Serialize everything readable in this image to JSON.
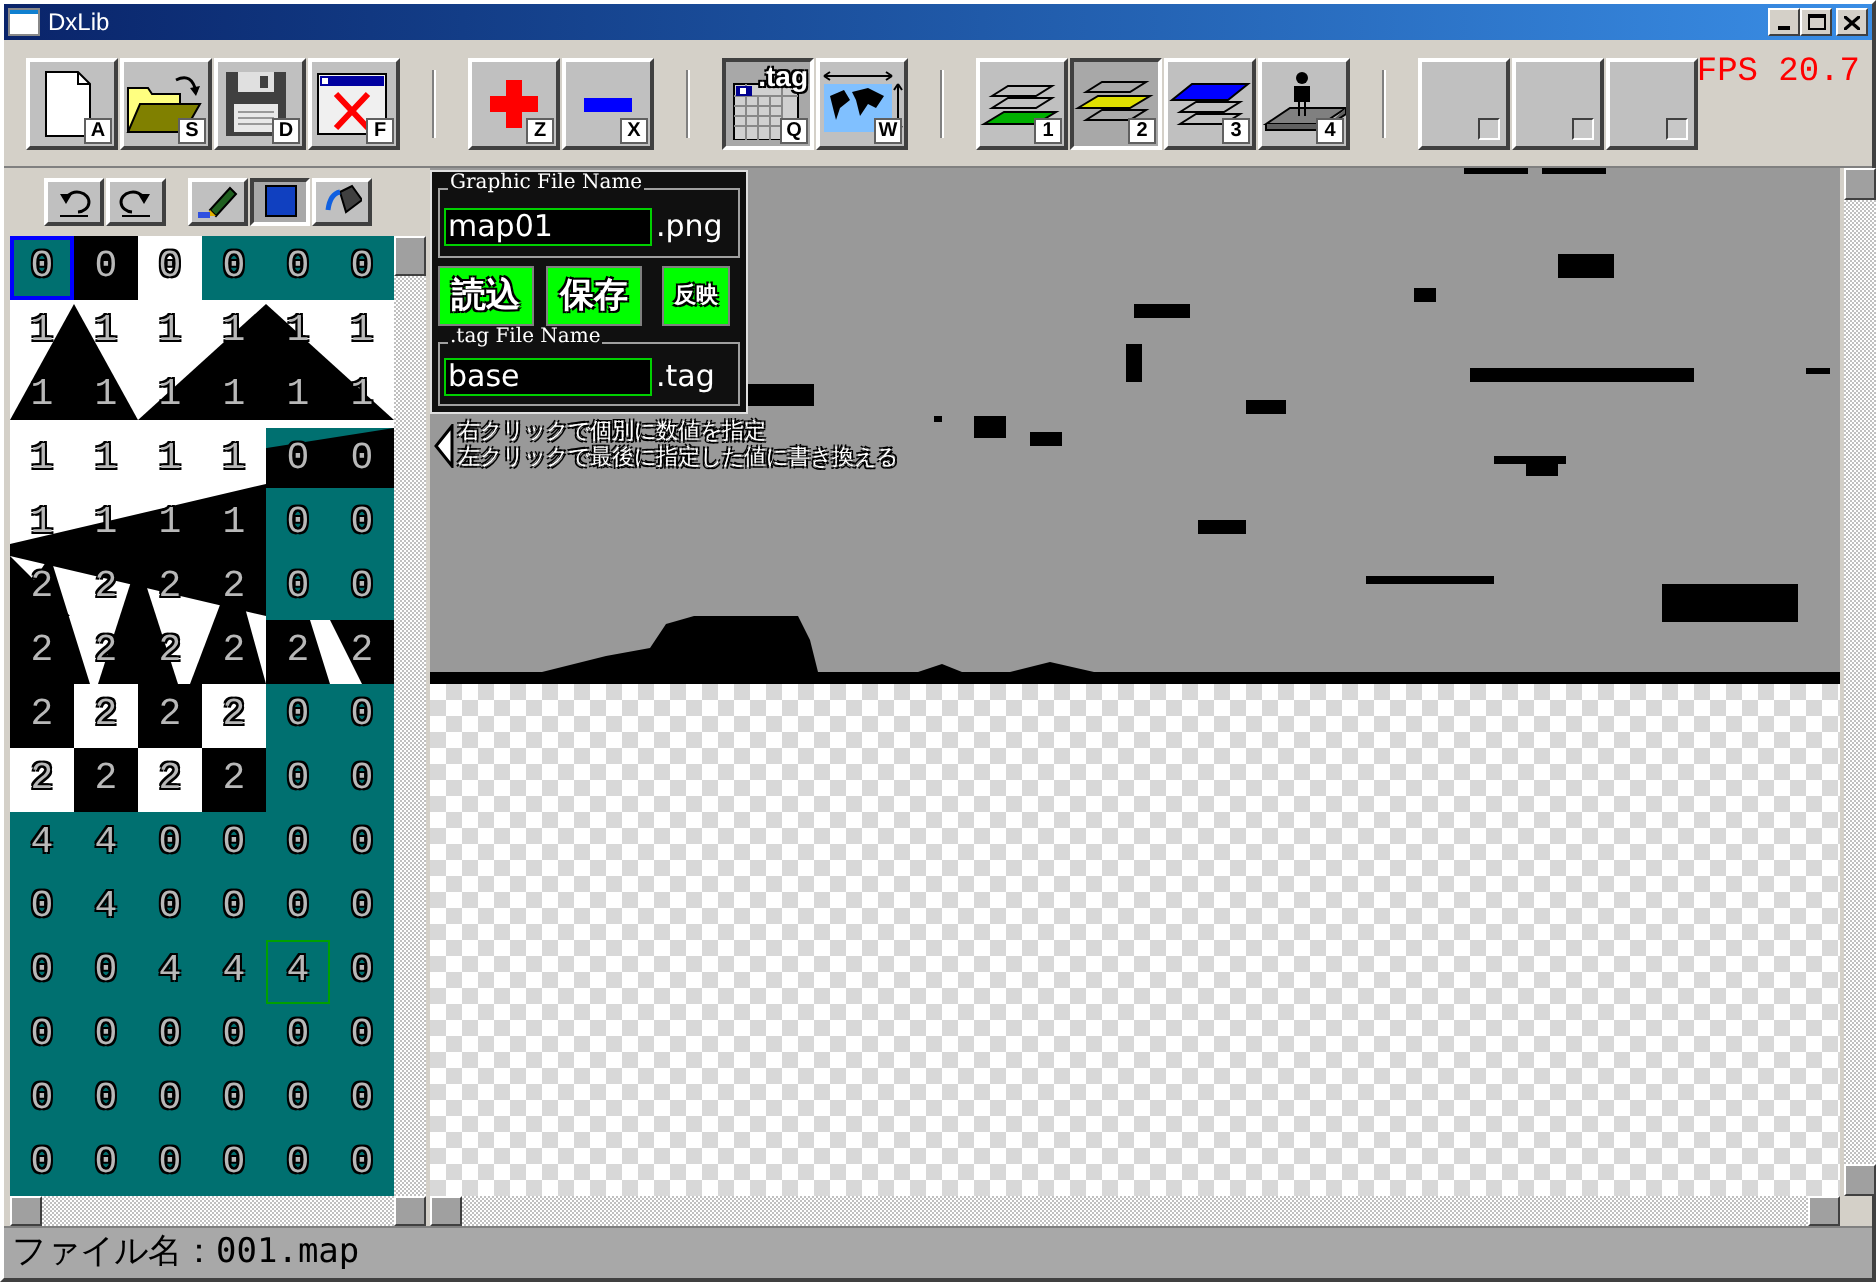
{
  "window": {
    "title": "DxLib"
  },
  "toolbar": {
    "groups": [
      [
        {
          "kind": "new",
          "key": "A",
          "selected": false
        },
        {
          "kind": "open",
          "key": "S",
          "selected": false
        },
        {
          "kind": "save",
          "key": "D",
          "selected": false
        },
        {
          "kind": "close",
          "key": "F",
          "selected": false
        }
      ],
      [
        {
          "kind": "add",
          "key": "Z",
          "selected": false
        },
        {
          "kind": "remove",
          "key": "X",
          "selected": false
        }
      ],
      [
        {
          "kind": "tag",
          "key": "Q",
          "label": ".tag",
          "selected": true
        },
        {
          "kind": "map",
          "key": "W",
          "selected": false
        }
      ],
      [
        {
          "kind": "layer1",
          "key": "1",
          "selected": false
        },
        {
          "kind": "layer2",
          "key": "2",
          "selected": true
        },
        {
          "kind": "layer3",
          "key": "3",
          "selected": false
        },
        {
          "kind": "layer4",
          "key": "4",
          "selected": false
        }
      ],
      [
        {
          "kind": "blank",
          "selected": false
        },
        {
          "kind": "blank",
          "selected": false
        },
        {
          "kind": "blank",
          "selected": false
        }
      ]
    ],
    "fps": "FPS 20.7"
  },
  "tool_palette": [
    {
      "kind": "undo",
      "selected": false
    },
    {
      "kind": "redo",
      "selected": false
    },
    {
      "kind": "pen",
      "selected": false
    },
    {
      "kind": "rect",
      "selected": true
    },
    {
      "kind": "bucket",
      "selected": false
    }
  ],
  "tile_grid": {
    "rows": [
      [
        {
          "value": "0",
          "selected": true,
          "cursor": false
        },
        {
          "value": "0",
          "selected": false,
          "cursor": false
        },
        {
          "value": "0",
          "selected": false,
          "cursor": false
        },
        {
          "value": "0",
          "selected": false,
          "cursor": false
        },
        {
          "value": "0",
          "selected": false,
          "cursor": false
        },
        {
          "value": "0",
          "selected": false,
          "cursor": false
        }
      ],
      [
        {
          "value": "1",
          "selected": false,
          "cursor": false
        },
        {
          "value": "1",
          "selected": false,
          "cursor": false
        },
        {
          "value": "1",
          "selected": false,
          "cursor": false
        },
        {
          "value": "1",
          "selected": false,
          "cursor": false
        },
        {
          "value": "1",
          "selected": false,
          "cursor": false
        },
        {
          "value": "1",
          "selected": false,
          "cursor": false
        }
      ],
      [
        {
          "value": "1",
          "selected": false,
          "cursor": false
        },
        {
          "value": "1",
          "selected": false,
          "cursor": false
        },
        {
          "value": "1",
          "selected": false,
          "cursor": false
        },
        {
          "value": "1",
          "selected": false,
          "cursor": false
        },
        {
          "value": "1",
          "selected": false,
          "cursor": false
        },
        {
          "value": "1",
          "selected": false,
          "cursor": false
        }
      ],
      [
        {
          "value": "1",
          "selected": false,
          "cursor": false
        },
        {
          "value": "1",
          "selected": false,
          "cursor": false
        },
        {
          "value": "1",
          "selected": false,
          "cursor": false
        },
        {
          "value": "1",
          "selected": false,
          "cursor": false
        },
        {
          "value": "0",
          "selected": false,
          "cursor": false
        },
        {
          "value": "0",
          "selected": false,
          "cursor": false
        }
      ],
      [
        {
          "value": "1",
          "selected": false,
          "cursor": false
        },
        {
          "value": "1",
          "selected": false,
          "cursor": false
        },
        {
          "value": "1",
          "selected": false,
          "cursor": false
        },
        {
          "value": "1",
          "selected": false,
          "cursor": false
        },
        {
          "value": "0",
          "selected": false,
          "cursor": false
        },
        {
          "value": "0",
          "selected": false,
          "cursor": false
        }
      ],
      [
        {
          "value": "2",
          "selected": false,
          "cursor": false
        },
        {
          "value": "2",
          "selected": false,
          "cursor": false
        },
        {
          "value": "2",
          "selected": false,
          "cursor": false
        },
        {
          "value": "2",
          "selected": false,
          "cursor": false
        },
        {
          "value": "0",
          "selected": false,
          "cursor": false
        },
        {
          "value": "0",
          "selected": false,
          "cursor": false
        }
      ],
      [
        {
          "value": "2",
          "selected": false,
          "cursor": false
        },
        {
          "value": "2",
          "selected": false,
          "cursor": false
        },
        {
          "value": "2",
          "selected": false,
          "cursor": false
        },
        {
          "value": "2",
          "selected": false,
          "cursor": false
        },
        {
          "value": "2",
          "selected": false,
          "cursor": false
        },
        {
          "value": "2",
          "selected": false,
          "cursor": false
        }
      ],
      [
        {
          "value": "2",
          "selected": false,
          "cursor": false
        },
        {
          "value": "2",
          "selected": false,
          "cursor": false
        },
        {
          "value": "2",
          "selected": false,
          "cursor": false
        },
        {
          "value": "2",
          "selected": false,
          "cursor": false
        },
        {
          "value": "0",
          "selected": false,
          "cursor": false
        },
        {
          "value": "0",
          "selected": false,
          "cursor": false
        }
      ],
      [
        {
          "value": "2",
          "selected": false,
          "cursor": false
        },
        {
          "value": "2",
          "selected": false,
          "cursor": false
        },
        {
          "value": "2",
          "selected": false,
          "cursor": false
        },
        {
          "value": "2",
          "selected": false,
          "cursor": false
        },
        {
          "value": "0",
          "selected": false,
          "cursor": false
        },
        {
          "value": "0",
          "selected": false,
          "cursor": false
        }
      ],
      [
        {
          "value": "4",
          "selected": false,
          "cursor": false
        },
        {
          "value": "4",
          "selected": false,
          "cursor": false
        },
        {
          "value": "0",
          "selected": false,
          "cursor": false
        },
        {
          "value": "0",
          "selected": false,
          "cursor": false
        },
        {
          "value": "0",
          "selected": false,
          "cursor": false
        },
        {
          "value": "0",
          "selected": false,
          "cursor": false
        }
      ],
      [
        {
          "value": "0",
          "selected": false,
          "cursor": false
        },
        {
          "value": "4",
          "selected": false,
          "cursor": false
        },
        {
          "value": "0",
          "selected": false,
          "cursor": false
        },
        {
          "value": "0",
          "selected": false,
          "cursor": false
        },
        {
          "value": "0",
          "selected": false,
          "cursor": false
        },
        {
          "value": "0",
          "selected": false,
          "cursor": false
        }
      ],
      [
        {
          "value": "0",
          "selected": false,
          "cursor": false
        },
        {
          "value": "0",
          "selected": false,
          "cursor": false
        },
        {
          "value": "4",
          "selected": false,
          "cursor": false
        },
        {
          "value": "4",
          "selected": false,
          "cursor": false
        },
        {
          "value": "4",
          "selected": false,
          "cursor": true
        },
        {
          "value": "0",
          "selected": false,
          "cursor": false
        }
      ],
      [
        {
          "value": "0",
          "selected": false,
          "cursor": false
        },
        {
          "value": "0",
          "selected": false,
          "cursor": false
        },
        {
          "value": "0",
          "selected": false,
          "cursor": false
        },
        {
          "value": "0",
          "selected": false,
          "cursor": false
        },
        {
          "value": "0",
          "selected": false,
          "cursor": false
        },
        {
          "value": "0",
          "selected": false,
          "cursor": false
        }
      ],
      [
        {
          "value": "0",
          "selected": false,
          "cursor": false
        },
        {
          "value": "0",
          "selected": false,
          "cursor": false
        },
        {
          "value": "0",
          "selected": false,
          "cursor": false
        },
        {
          "value": "0",
          "selected": false,
          "cursor": false
        },
        {
          "value": "0",
          "selected": false,
          "cursor": false
        },
        {
          "value": "0",
          "selected": false,
          "cursor": false
        }
      ],
      [
        {
          "value": "0",
          "selected": false,
          "cursor": false
        },
        {
          "value": "0",
          "selected": false,
          "cursor": false
        },
        {
          "value": "0",
          "selected": false,
          "cursor": false
        },
        {
          "value": "0",
          "selected": false,
          "cursor": false
        },
        {
          "value": "0",
          "selected": false,
          "cursor": false
        },
        {
          "value": "0",
          "selected": false,
          "cursor": false
        }
      ]
    ]
  },
  "file_panel": {
    "graphic_label": "Graphic File Name",
    "graphic_name": "map01",
    "graphic_ext": ".png",
    "buttons": [
      "読込",
      "保存",
      "反映"
    ],
    "tag_label": ".tag File Name",
    "tag_name": "base",
    "tag_ext": ".tag"
  },
  "hint": [
    "右クリックで個別に数値を指定",
    "左クリックで最後に指定した値に書き換える"
  ],
  "status_bar": "ファイル名：001.map"
}
